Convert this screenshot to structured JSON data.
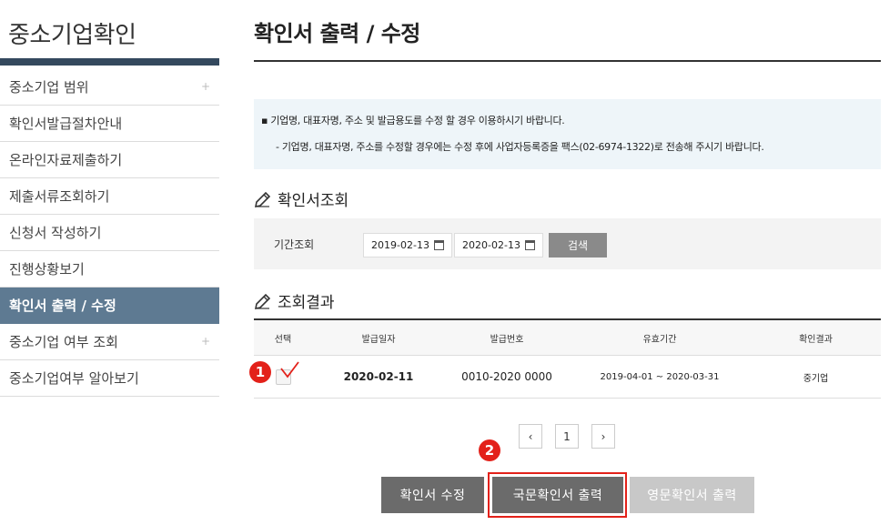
{
  "sidebar": {
    "title": "중소기업확인",
    "items": [
      {
        "label": "중소기업 범위",
        "plus": "+"
      },
      {
        "label": "확인서발급절차안내"
      },
      {
        "label": "온라인자료제출하기"
      },
      {
        "label": "제출서류조회하기"
      },
      {
        "label": "신청서 작성하기"
      },
      {
        "label": "진행상황보기"
      },
      {
        "label": "확인서 출력 / 수정",
        "active": true
      },
      {
        "label": "중소기업 여부 조회",
        "plus": "+"
      },
      {
        "label": "중소기업여부 알아보기"
      }
    ]
  },
  "main": {
    "title": "확인서 출력 / 수정",
    "notice": {
      "line1": "▪ 기업명, 대표자명, 주소 및 발급용도를 수정 할 경우 이용하시기 바랍니다.",
      "line2": "- 기업명, 대표자명, 주소를 수정할 경우에는 수정 후에 사업자등록증을 팩스(02-6974-1322)로 전송해 주시기 바랍니다."
    },
    "search_section": {
      "heading": "확인서조회",
      "period_label": "기간조회",
      "date_from": "2019-02-13",
      "date_to": "2020-02-13",
      "search_button": "검색"
    },
    "result_section": {
      "heading": "조회결과",
      "columns": [
        "선택",
        "발급일자",
        "발급번호",
        "유효기간",
        "확인결과"
      ],
      "rows": [
        {
          "date": "2020-02-11",
          "number": "0010-2020 0000",
          "validity": "2019-04-01 ~ 2020-03-31",
          "result": "중기업"
        }
      ]
    },
    "pagination": {
      "prev": "‹",
      "current": "1",
      "next": "›"
    },
    "actions": {
      "edit": "확인서 수정",
      "print_korean": "국문확인서 출력",
      "print_english": "영문확인서 출력"
    },
    "markers": {
      "one": "1",
      "two": "2"
    }
  },
  "colors": {
    "sidebar_active": "#5e7a92",
    "marker": "#e3211a",
    "button_dark": "#6b6b6b",
    "button_disabled": "#c8c8c8"
  }
}
